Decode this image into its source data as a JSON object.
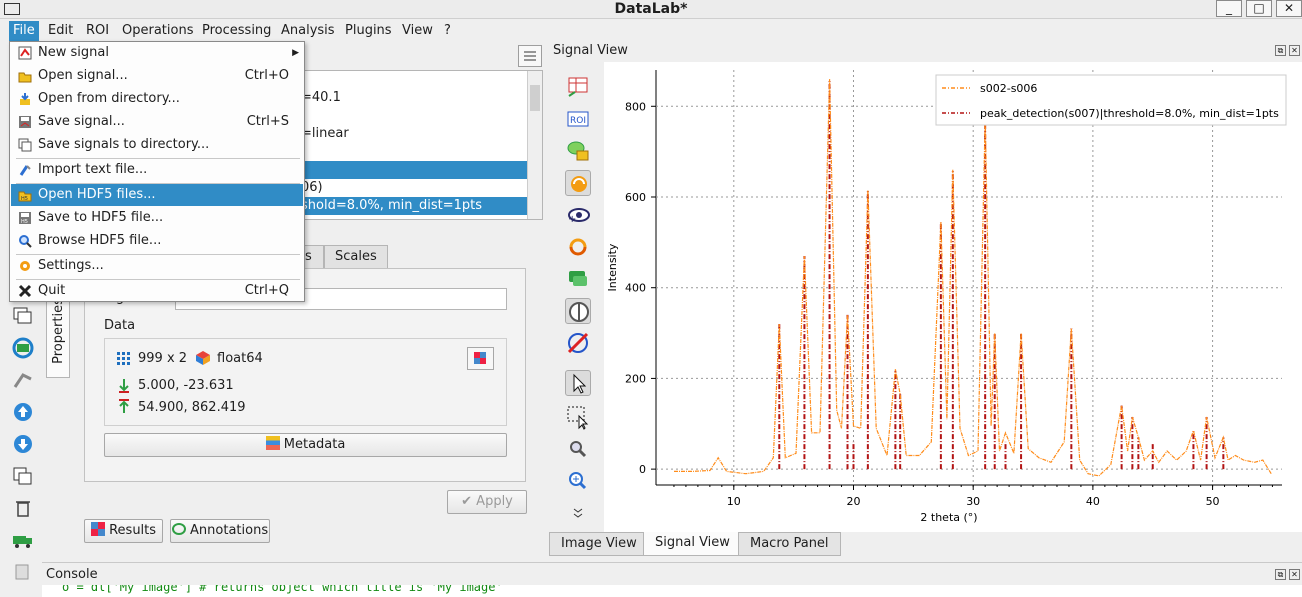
{
  "window": {
    "title": "DataLab*"
  },
  "menubar": [
    "File",
    "Edit",
    "ROI",
    "Operations",
    "Processing",
    "Analysis",
    "Plugins",
    "View",
    "?"
  ],
  "file_menu": [
    {
      "label": "New signal",
      "shortcut": "",
      "icon": "new-signal-icon",
      "submenu": true
    },
    {
      "label": "Open signal...",
      "shortcut": "Ctrl+O",
      "icon": "open-folder-icon"
    },
    {
      "label": "Open from directory...",
      "shortcut": "",
      "icon": "open-directory-icon"
    },
    {
      "label": "Save signal...",
      "shortcut": "Ctrl+S",
      "icon": "save-icon"
    },
    {
      "label": "Save signals to directory...",
      "shortcut": "",
      "icon": "save-directory-icon"
    },
    {
      "label": "Import text file...",
      "shortcut": "",
      "icon": "import-text-icon"
    },
    {
      "label": "Open HDF5 files...",
      "shortcut": "",
      "icon": "open-hdf5-icon",
      "highlighted": true
    },
    {
      "label": "Save to HDF5 file...",
      "shortcut": "",
      "icon": "save-hdf5-icon"
    },
    {
      "label": "Browse HDF5 file...",
      "shortcut": "",
      "icon": "browse-hdf5-icon"
    },
    {
      "label": "Settings...",
      "shortcut": "",
      "icon": "settings-icon"
    },
    {
      "label": "Quit",
      "shortcut": "Ctrl+Q",
      "icon": "close-icon"
    }
  ],
  "signal_list": [
    {
      "text": "=40.1",
      "selected": false
    },
    {
      "text": "",
      "selected": false
    },
    {
      "text": "=linear",
      "selected": false
    },
    {
      "text": "",
      "selected": false
    },
    {
      "text": "",
      "selected": true
    },
    {
      "text": "06)",
      "selected": false
    },
    {
      "text": "shold=8.0%, min_dist=1pts",
      "selected": true
    }
  ],
  "tabs": {
    "partial": "s",
    "scales": "Scales",
    "properties": "Properties"
  },
  "properties": {
    "signal_title_label": "Signal title",
    "signal_title_value": "s002-s006",
    "data_label": "Data",
    "shape": "999 x 2",
    "dtype": "float64",
    "xy_min": "5.000, -23.631",
    "xy_max": "54.900, 862.419",
    "metadata_button": "Metadata",
    "apply_button": "Apply",
    "results_button": "Results",
    "annotations_button": "Annotations"
  },
  "signal_view": {
    "title": "Signal View"
  },
  "bottom_tabs": [
    "Image View",
    "Signal View",
    "Macro Panel"
  ],
  "console": {
    "title": "Console",
    "line": "o = dl['My image']  # returns object which title is 'My image'"
  },
  "chart_data": {
    "type": "line",
    "xlabel": "2 theta (°)",
    "ylabel": "Intensity",
    "xlim": [
      3.5,
      55.8
    ],
    "ylim": [
      -35,
      880
    ],
    "xticks": [
      10,
      20,
      30,
      40,
      50
    ],
    "yticks": [
      0,
      200,
      400,
      600,
      800
    ],
    "grid": true,
    "legend_placement": "top-right",
    "colors": {
      "s1": "#ff8c1a",
      "s2": "#b31414"
    },
    "series": [
      {
        "name": "s002-s006",
        "x": [
          5.0,
          6.5,
          8.0,
          8.7,
          9.4,
          11.0,
          12.5,
          13.3,
          13.8,
          14.3,
          15.2,
          15.9,
          16.5,
          17.2,
          18.0,
          18.6,
          19.0,
          19.5,
          20.0,
          20.6,
          21.2,
          21.9,
          22.8,
          23.5,
          23.9,
          24.4,
          25.5,
          26.5,
          27.3,
          27.8,
          28.3,
          28.9,
          29.6,
          30.4,
          31.0,
          31.5,
          31.8,
          32.2,
          32.7,
          33.4,
          34.0,
          34.6,
          35.5,
          36.5,
          37.6,
          38.2,
          38.9,
          39.6,
          40.5,
          41.5,
          42.4,
          42.9,
          43.3,
          43.8,
          44.3,
          45.0,
          45.5,
          46.2,
          47.0,
          47.8,
          48.4,
          49.0,
          49.5,
          50.2,
          50.9,
          51.3,
          51.9,
          52.6,
          53.5,
          54.2,
          54.9
        ],
        "y": [
          -5,
          -5,
          -3,
          25,
          -5,
          -10,
          -5,
          25,
          320,
          25,
          35,
          470,
          80,
          80,
          860,
          130,
          90,
          340,
          95,
          90,
          615,
          90,
          30,
          220,
          165,
          30,
          30,
          60,
          545,
          110,
          660,
          90,
          30,
          40,
          775,
          95,
          300,
          40,
          80,
          35,
          300,
          45,
          25,
          15,
          60,
          310,
          20,
          -10,
          -15,
          10,
          140,
          40,
          115,
          70,
          20,
          40,
          15,
          40,
          20,
          40,
          85,
          20,
          115,
          25,
          70,
          20,
          30,
          20,
          15,
          20,
          -10
        ]
      },
      {
        "name": "peak_detection(s007)|threshold=8.0%, min_dist=1pts",
        "x": [
          13.8,
          15.9,
          18.0,
          19.5,
          20.0,
          21.2,
          23.5,
          23.9,
          27.3,
          28.3,
          31.0,
          31.8,
          32.7,
          34.0,
          38.2,
          42.4,
          43.3,
          43.8,
          45.0,
          48.4,
          49.5,
          50.9
        ],
        "y": [
          320,
          470,
          860,
          340,
          60,
          615,
          220,
          165,
          545,
          660,
          775,
          300,
          60,
          300,
          310,
          140,
          115,
          70,
          55,
          85,
          115,
          70
        ]
      }
    ]
  }
}
